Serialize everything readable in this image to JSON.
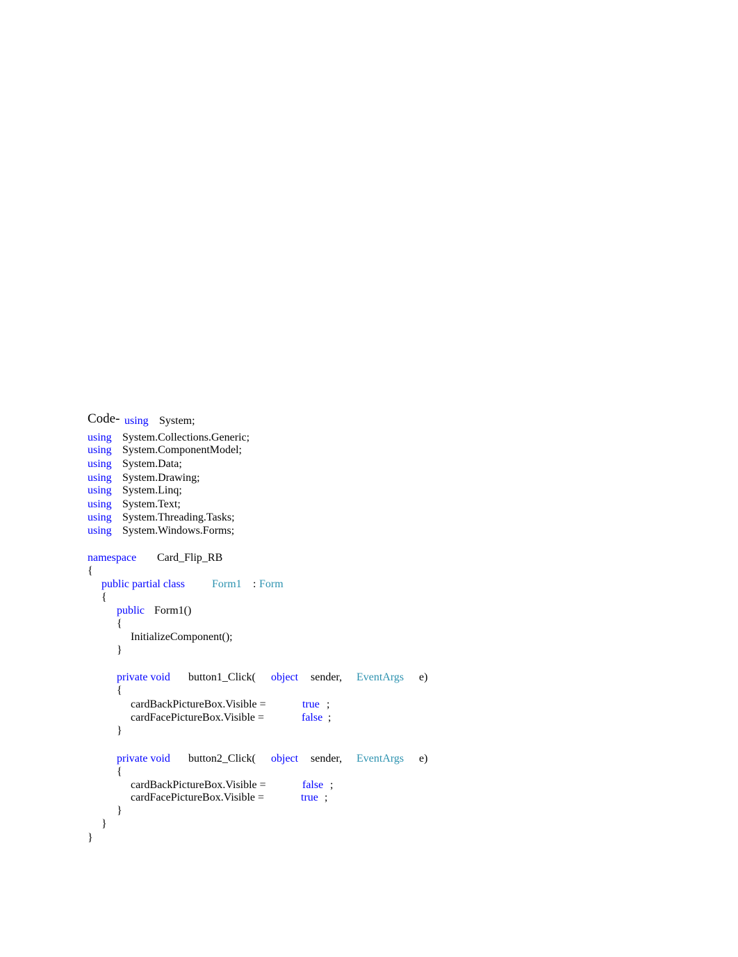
{
  "document": {
    "label": "Code-",
    "colors": {
      "keyword": "#0000ff",
      "type": "#2b91af",
      "text": "#000000"
    },
    "lines": [
      [
        {
          "t": "kw",
          "v": "using"
        },
        {
          "t": "tx",
          "v": "System;"
        }
      ],
      [
        {
          "t": "kw",
          "v": "using"
        },
        {
          "t": "tx",
          "v": "System.Collections.Generic;"
        }
      ],
      [
        {
          "t": "kw",
          "v": "using"
        },
        {
          "t": "tx",
          "v": "System.ComponentModel;"
        }
      ],
      [
        {
          "t": "kw",
          "v": "using"
        },
        {
          "t": "tx",
          "v": "System.Data;"
        }
      ],
      [
        {
          "t": "kw",
          "v": "using"
        },
        {
          "t": "tx",
          "v": "System.Drawing;"
        }
      ],
      [
        {
          "t": "kw",
          "v": "using"
        },
        {
          "t": "tx",
          "v": "System.Linq;"
        }
      ],
      [
        {
          "t": "kw",
          "v": "using"
        },
        {
          "t": "tx",
          "v": "System.Text;"
        }
      ],
      [
        {
          "t": "kw",
          "v": "using"
        },
        {
          "t": "tx",
          "v": "System.Threading.Tasks;"
        }
      ],
      [
        {
          "t": "kw",
          "v": "using"
        },
        {
          "t": "tx",
          "v": "System.Windows.Forms;"
        }
      ],
      [
        {
          "t": "kw",
          "v": "namespace"
        },
        {
          "t": "tx",
          "v": "Card_Flip_RB"
        }
      ],
      [
        {
          "t": "tx",
          "v": "{"
        }
      ],
      [
        {
          "t": "kw",
          "v": "public partial class"
        },
        {
          "t": "ty",
          "v": "Form1"
        },
        {
          "t": "tx",
          "v": ":"
        },
        {
          "t": "ty",
          "v": "Form"
        }
      ],
      [
        {
          "t": "tx",
          "v": "{"
        }
      ],
      [
        {
          "t": "kw",
          "v": "public"
        },
        {
          "t": "tx",
          "v": "Form1()"
        }
      ],
      [
        {
          "t": "tx",
          "v": "{"
        }
      ],
      [
        {
          "t": "tx",
          "v": "InitializeComponent();"
        }
      ],
      [
        {
          "t": "tx",
          "v": "}"
        }
      ],
      [
        {
          "t": "kw",
          "v": "private void"
        },
        {
          "t": "tx",
          "v": "button1_Click("
        },
        {
          "t": "kw",
          "v": "object"
        },
        {
          "t": "tx",
          "v": "sender,"
        },
        {
          "t": "ty",
          "v": "EventArgs"
        },
        {
          "t": "tx",
          "v": "e)"
        }
      ],
      [
        {
          "t": "tx",
          "v": "{"
        }
      ],
      [
        {
          "t": "tx",
          "v": "cardBackPictureBox.Visible ="
        },
        {
          "t": "kw",
          "v": "true"
        },
        {
          "t": "tx",
          "v": ";"
        }
      ],
      [
        {
          "t": "tx",
          "v": "cardFacePictureBox.Visible ="
        },
        {
          "t": "kw",
          "v": "false"
        },
        {
          "t": "tx",
          "v": ";"
        }
      ],
      [
        {
          "t": "tx",
          "v": "}"
        }
      ],
      [
        {
          "t": "kw",
          "v": "private void"
        },
        {
          "t": "tx",
          "v": "button2_Click("
        },
        {
          "t": "kw",
          "v": "object"
        },
        {
          "t": "tx",
          "v": "sender,"
        },
        {
          "t": "ty",
          "v": "EventArgs"
        },
        {
          "t": "tx",
          "v": "e)"
        }
      ],
      [
        {
          "t": "tx",
          "v": "{"
        }
      ],
      [
        {
          "t": "tx",
          "v": "cardBackPictureBox.Visible ="
        },
        {
          "t": "kw",
          "v": "false"
        },
        {
          "t": "tx",
          "v": ";"
        }
      ],
      [
        {
          "t": "tx",
          "v": "cardFacePictureBox.Visible ="
        },
        {
          "t": "kw",
          "v": "true"
        },
        {
          "t": "tx",
          "v": ";"
        }
      ],
      [
        {
          "t": "tx",
          "v": "}"
        }
      ],
      [
        {
          "t": "tx",
          "v": "}"
        }
      ],
      [
        {
          "t": "tx",
          "v": "}"
        }
      ]
    ]
  }
}
